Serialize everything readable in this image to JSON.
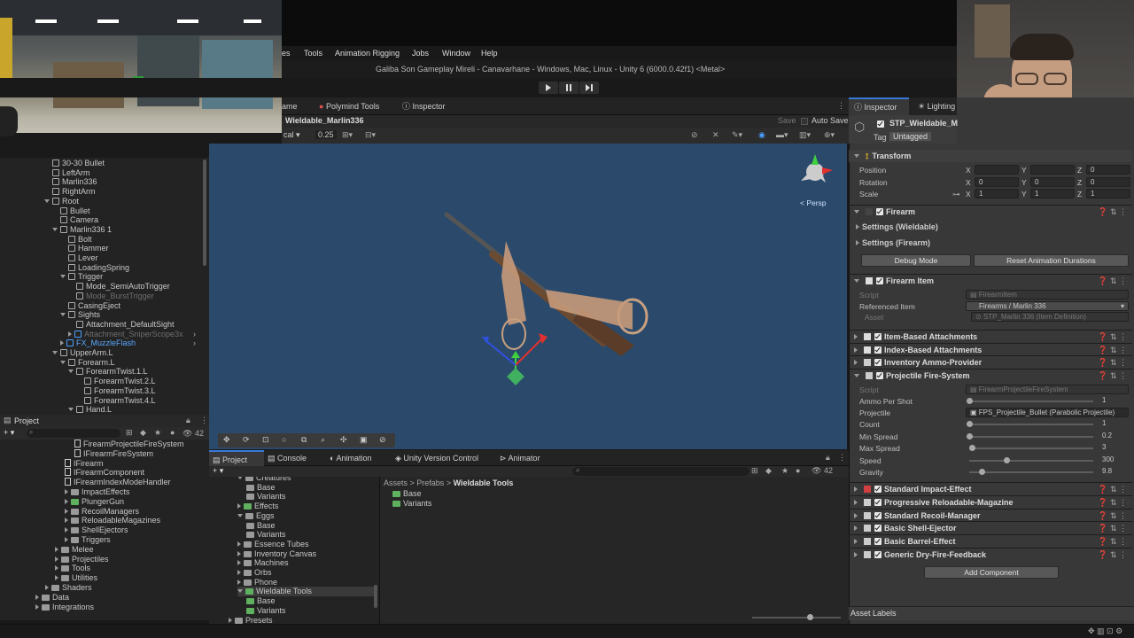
{
  "menubar": {
    "items": [
      "es",
      "Tools",
      "Animation Rigging",
      "Jobs",
      "Window",
      "Help"
    ]
  },
  "window_title": "Galiba Son Gameplay Mireli - Canavarhane - Windows, Mac, Linux - Unity 6 (6000.0.42f1) <Metal>",
  "center_tabs": [
    "ame",
    "Polymind Tools",
    "Inspector"
  ],
  "scene": {
    "title": "Wieldable_Marlin336",
    "save_label": "Save",
    "autosave_label": "Auto Save",
    "mode_label": "cal",
    "zoom_value": "0.25",
    "persp_label": "< Persp"
  },
  "hierarchy": [
    {
      "indent": 0,
      "label": "30-30 Bullet",
      "arrow": "none",
      "icon": "cube",
      "dim": false
    },
    {
      "indent": 0,
      "label": "LeftArm",
      "arrow": "none",
      "icon": "cube",
      "dim": false
    },
    {
      "indent": 0,
      "label": "Marlin336",
      "arrow": "none",
      "icon": "cube",
      "dim": false
    },
    {
      "indent": 0,
      "label": "RightArm",
      "arrow": "none",
      "icon": "cube",
      "dim": false
    },
    {
      "indent": 0,
      "label": "Root",
      "arrow": "down",
      "icon": "cube",
      "dim": false
    },
    {
      "indent": 1,
      "label": "Bullet",
      "arrow": "none",
      "icon": "cube",
      "dim": false
    },
    {
      "indent": 1,
      "label": "Camera",
      "arrow": "none",
      "icon": "cube",
      "dim": false
    },
    {
      "indent": 1,
      "label": "Marlin336 1",
      "arrow": "down",
      "icon": "cube",
      "dim": false
    },
    {
      "indent": 2,
      "label": "Bolt",
      "arrow": "none",
      "icon": "cube",
      "dim": false
    },
    {
      "indent": 2,
      "label": "Hammer",
      "arrow": "none",
      "icon": "cube",
      "dim": false
    },
    {
      "indent": 2,
      "label": "Lever",
      "arrow": "none",
      "icon": "cube",
      "dim": false
    },
    {
      "indent": 2,
      "label": "LoadingSpring",
      "arrow": "none",
      "icon": "cube",
      "dim": false
    },
    {
      "indent": 2,
      "label": "Trigger",
      "arrow": "down",
      "icon": "cube",
      "dim": false
    },
    {
      "indent": 3,
      "label": "Mode_SemiAutoTrigger",
      "arrow": "none",
      "icon": "cube",
      "dim": false
    },
    {
      "indent": 3,
      "label": "Mode_BurstTrigger",
      "arrow": "none",
      "icon": "cube",
      "dim": true
    },
    {
      "indent": 2,
      "label": "CasingEject",
      "arrow": "none",
      "icon": "cube",
      "dim": false
    },
    {
      "indent": 2,
      "label": "Sights",
      "arrow": "down",
      "icon": "cube",
      "dim": false
    },
    {
      "indent": 3,
      "label": "Attachment_DefaultSight",
      "arrow": "none",
      "icon": "cube",
      "dim": false
    },
    {
      "indent": 3,
      "label": "Attachment_SniperScope3x",
      "arrow": "right",
      "icon": "cubeblue",
      "dim": true
    },
    {
      "indent": 2,
      "label": "FX_MuzzleFlash",
      "arrow": "right",
      "icon": "cubeblue",
      "dim": false,
      "blue": true
    },
    {
      "indent": 1,
      "label": "UpperArm.L",
      "arrow": "down",
      "icon": "cube",
      "dim": false
    },
    {
      "indent": 2,
      "label": "Forearm.L",
      "arrow": "down",
      "icon": "cube",
      "dim": false
    },
    {
      "indent": 3,
      "label": "ForearmTwist.1.L",
      "arrow": "down",
      "icon": "cube",
      "dim": false
    },
    {
      "indent": 4,
      "label": "ForearmTwist.2.L",
      "arrow": "none",
      "icon": "cube",
      "dim": false
    },
    {
      "indent": 4,
      "label": "ForearmTwist.3.L",
      "arrow": "none",
      "icon": "cube",
      "dim": false
    },
    {
      "indent": 4,
      "label": "ForearmTwist.4.L",
      "arrow": "none",
      "icon": "cube",
      "dim": false
    },
    {
      "indent": 3,
      "label": "Hand.L",
      "arrow": "down",
      "icon": "cube",
      "dim": false
    }
  ],
  "project_left": {
    "title": "Project",
    "count": "42",
    "items": [
      {
        "indent": 4,
        "label": "FirearmProjectileFireSystem",
        "icon": "doc"
      },
      {
        "indent": 4,
        "label": "IFirearmFireSystem",
        "icon": "doc"
      },
      {
        "indent": 3,
        "label": "IFirearm",
        "icon": "doc"
      },
      {
        "indent": 3,
        "label": "IFirearmComponent",
        "icon": "doc"
      },
      {
        "indent": 3,
        "label": "IFirearmIndexModeHandler",
        "icon": "doc"
      },
      {
        "indent": 3,
        "label": "ImpactEffects",
        "icon": "folder"
      },
      {
        "indent": 3,
        "label": "PlungerGun",
        "icon": "foldergreen"
      },
      {
        "indent": 3,
        "label": "RecoilManagers",
        "icon": "folder"
      },
      {
        "indent": 3,
        "label": "ReloadableMagazines",
        "icon": "folder"
      },
      {
        "indent": 3,
        "label": "ShellEjectors",
        "icon": "folder"
      },
      {
        "indent": 3,
        "label": "Triggers",
        "icon": "folder"
      },
      {
        "indent": 2,
        "label": "Melee",
        "icon": "folder"
      },
      {
        "indent": 2,
        "label": "Projectiles",
        "icon": "folder"
      },
      {
        "indent": 2,
        "label": "Tools",
        "icon": "folder"
      },
      {
        "indent": 2,
        "label": "Utilities",
        "icon": "folder"
      },
      {
        "indent": 1,
        "label": "Shaders",
        "icon": "folder"
      },
      {
        "indent": 0,
        "label": "Data",
        "icon": "folder"
      },
      {
        "indent": 0,
        "label": "Integrations",
        "icon": "folder"
      }
    ]
  },
  "bottom_tabs": [
    "Project",
    "Console",
    "Animation",
    "Unity Version Control",
    "Animator"
  ],
  "project_tree": [
    {
      "indent": 1,
      "label": "Creatures",
      "icon": "folder"
    },
    {
      "indent": 2,
      "label": "Base",
      "icon": "folder"
    },
    {
      "indent": 2,
      "label": "Variants",
      "icon": "folder"
    },
    {
      "indent": 1,
      "label": "Effects",
      "icon": "foldergreen"
    },
    {
      "indent": 1,
      "label": "Eggs",
      "icon": "folder"
    },
    {
      "indent": 2,
      "label": "Base",
      "icon": "folder"
    },
    {
      "indent": 2,
      "label": "Variants",
      "icon": "folder"
    },
    {
      "indent": 1,
      "label": "Essence Tubes",
      "icon": "folder"
    },
    {
      "indent": 1,
      "label": "Inventory Canvas",
      "icon": "folder"
    },
    {
      "indent": 1,
      "label": "Machines",
      "icon": "folder"
    },
    {
      "indent": 1,
      "label": "Orbs",
      "icon": "folder"
    },
    {
      "indent": 1,
      "label": "Phone",
      "icon": "folder"
    },
    {
      "indent": 1,
      "label": "Wieldable Tools",
      "icon": "foldergreen",
      "selected": true
    },
    {
      "indent": 2,
      "label": "Base",
      "icon": "foldergreen"
    },
    {
      "indent": 2,
      "label": "Variants",
      "icon": "foldergreen"
    },
    {
      "indent": 0,
      "label": "Presets",
      "icon": "folder"
    }
  ],
  "breadcrumb": [
    "Assets",
    "Prefabs",
    "Wieldable Tools"
  ],
  "project_content": [
    "Base",
    "Variants"
  ],
  "project_count": "42",
  "inspector": {
    "tabs": [
      "Inspector",
      "Lighting"
    ],
    "object_name": "STP_Wieldable_M",
    "tag_label": "Tag",
    "tag_value": "Untagged",
    "transform": {
      "title": "Transform",
      "rows": [
        {
          "label": "Position",
          "x": "",
          "y": "",
          "z": "0"
        },
        {
          "label": "Rotation",
          "x": "0",
          "y": "0",
          "z": "0"
        },
        {
          "label": "Scale",
          "x": "1",
          "y": "1",
          "z": "1"
        }
      ]
    },
    "firearm": {
      "title": "Firearm",
      "settings_wieldable": "Settings (Wieldable)",
      "settings_firearm": "Settings (Firearm)",
      "debug_button": "Debug Mode",
      "reset_button": "Reset Animation Durations"
    },
    "firearm_item": {
      "title": "Firearm Item",
      "script_label": "Script",
      "script_value": "FirearmItem",
      "ref_label": "Referenced Item",
      "ref_value": "Firearms / Marlin 336",
      "asset_label": "Asset",
      "asset_value": "STP_Marlin 336 (Item Definition)"
    },
    "components_mid": [
      "Item-Based Attachments",
      "Index-Based Attachments",
      "Inventory Ammo-Provider"
    ],
    "fire_system": {
      "title": "Projectile Fire-System",
      "script_label": "Script",
      "script_value": "FirearmProjectileFireSystem",
      "props": [
        {
          "label": "Ammo Per Shot",
          "value": "1",
          "fraction": 0.0
        },
        {
          "label": "Projectile",
          "value": "FPS_Projectile_Bullet (Parabolic Projectile)",
          "type": "object"
        },
        {
          "label": "Count",
          "value": "1",
          "fraction": 0.0
        },
        {
          "label": "Min Spread",
          "value": "0.2",
          "fraction": 0.0
        },
        {
          "label": "Max Spread",
          "value": "3",
          "fraction": 0.02
        },
        {
          "label": "Speed",
          "value": "300",
          "fraction": 0.3
        },
        {
          "label": "Gravity",
          "value": "9.8",
          "fraction": 0.1
        }
      ]
    },
    "components_end": [
      {
        "title": "Standard Impact-Effect",
        "icon_color": "#d04040"
      },
      {
        "title": "Progressive Reloadable-Magazine",
        "icon_color": "#cccccc"
      },
      {
        "title": "Standard Recoil-Manager",
        "icon_color": "#cccccc"
      },
      {
        "title": "Basic Shell-Ejector",
        "icon_color": "#cccccc"
      },
      {
        "title": "Basic Barrel-Effect",
        "icon_color": "#cccccc"
      },
      {
        "title": "Generic Dry-Fire-Feedback",
        "icon_color": "#cccccc"
      }
    ],
    "add_component": "Add Component",
    "asset_labels": "Asset Labels"
  },
  "colors": {
    "scene_bg": "#2b4a6b",
    "accent": "#3a78d8",
    "green_folder": "#5fb05f"
  },
  "icons": [
    "play-icon",
    "pause-icon",
    "step-icon",
    "gear-icon",
    "lock-icon",
    "search-icon",
    "help-icon"
  ]
}
